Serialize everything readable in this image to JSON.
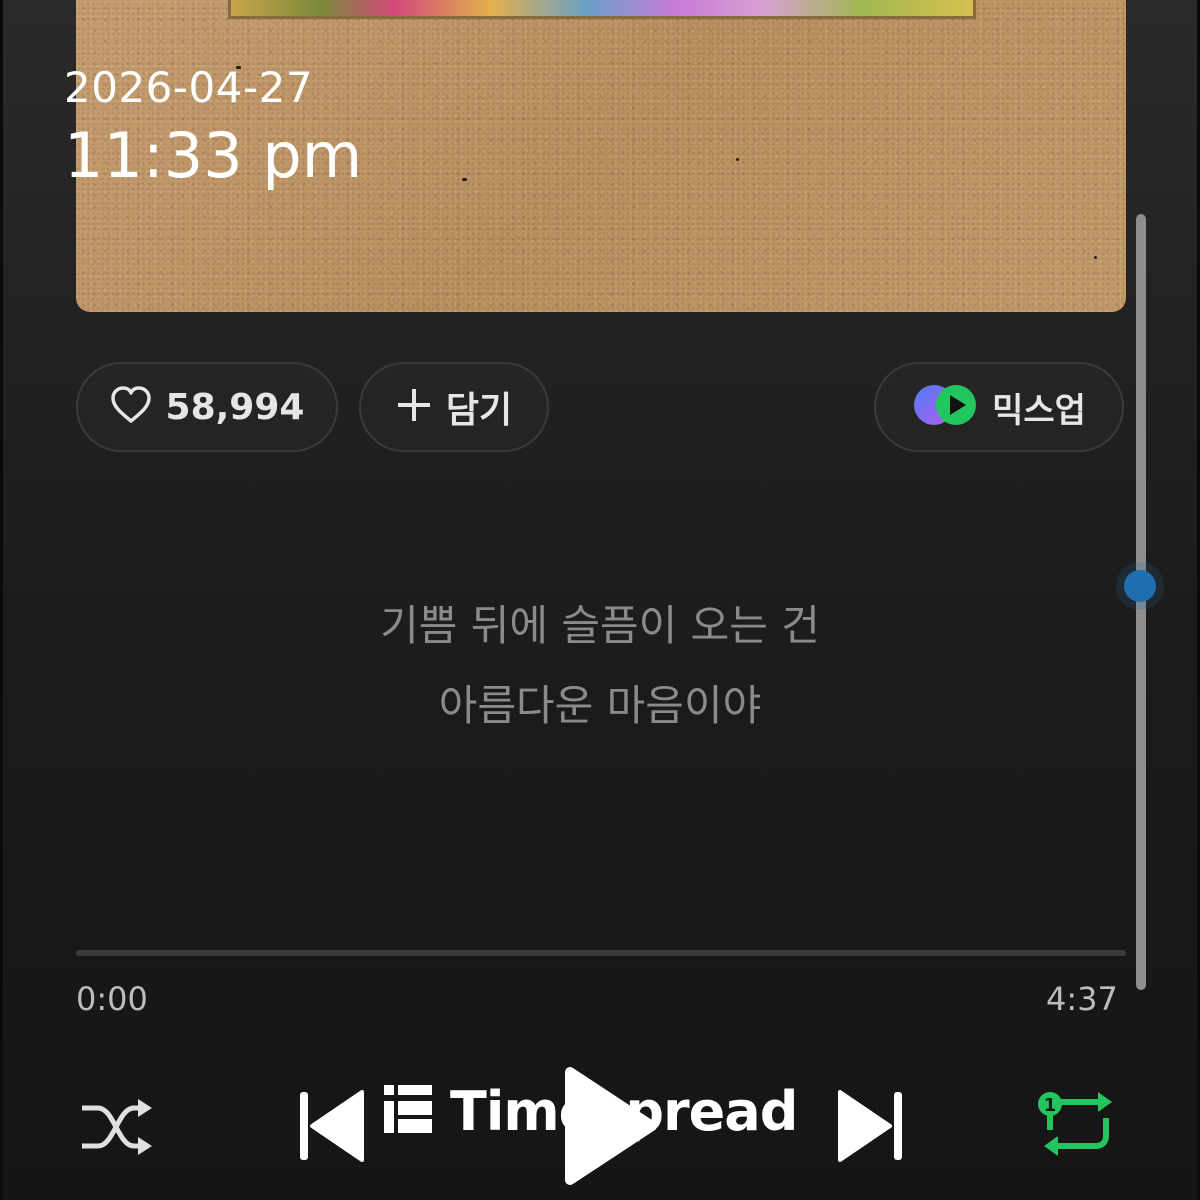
{
  "status": {
    "date": "2026-04-27",
    "time": "11:33 pm"
  },
  "actions": {
    "like_count": "58,994",
    "add_label": "담기",
    "mixup_label": "믹스업"
  },
  "lyrics": {
    "line1": "기쁨 뒤에 슬픔이 오는 건",
    "line2": "아름다운 마음이야"
  },
  "player": {
    "current_time": "0:00",
    "total_time": "4:37",
    "progress": 0.0,
    "repeat_mode": "1",
    "lyrics_scroll": 0.48
  },
  "watermark": {
    "text": "Timespread"
  },
  "icons": {
    "like": "heart-icon",
    "add": "plus-icon",
    "mixup": "mixup-logo-icon",
    "shuffle": "shuffle-icon",
    "prev": "skip-previous-icon",
    "play": "play-icon",
    "next": "skip-next-icon",
    "repeat": "repeat-one-icon"
  },
  "colors": {
    "repeat_active": "#22c55e",
    "scroll_thumb": "#1e6eb0"
  }
}
